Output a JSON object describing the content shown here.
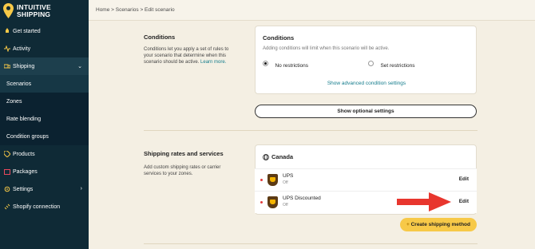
{
  "brand": {
    "line1": "INTUITIVE",
    "line2": "SHIPPING",
    "accent": "#f7c948",
    "sidebar_bg": "#0f2a36"
  },
  "sidebar": {
    "items": [
      {
        "label": "Get started",
        "icon": "rocket-icon"
      },
      {
        "label": "Activity",
        "icon": "activity-icon"
      },
      {
        "label": "Shipping",
        "icon": "truck-icon",
        "expanded": true
      },
      {
        "label": "Scenarios",
        "sub": true,
        "active": true
      },
      {
        "label": "Zones",
        "sub": true
      },
      {
        "label": "Rate blending",
        "sub": true
      },
      {
        "label": "Condition groups",
        "sub": true
      },
      {
        "label": "Products",
        "icon": "tag-icon"
      },
      {
        "label": "Packages",
        "icon": "package-icon"
      },
      {
        "label": "Settings",
        "icon": "gear-icon"
      },
      {
        "label": "Shopify connection",
        "icon": "link-icon"
      }
    ]
  },
  "breadcrumb": {
    "text": "Home > Scenarios > Edit scenario"
  },
  "conditions": {
    "title": "Conditions",
    "desc": "Conditions let you apply a set of rules to your scenario that determine when this scenario should be active.",
    "learn_more": "Learn more.",
    "card_title": "Conditions",
    "card_sub": "Adding conditions will limit when this scenario will be active.",
    "option_no": "No restrictions",
    "option_set": "Set restrictions",
    "advanced_link": "Show advanced condition settings"
  },
  "optional_button": "Show optional settings",
  "shipping": {
    "title": "Shipping rates and services",
    "desc": "Add custom shipping rates or carrier services to your zones.",
    "zone_title": "Canada",
    "services": [
      {
        "name": "UPS",
        "status": "Off",
        "edit": "Edit"
      },
      {
        "name": "UPS Discounted",
        "status": "Off",
        "edit": "Edit"
      }
    ],
    "create_button": "Create shipping method"
  }
}
